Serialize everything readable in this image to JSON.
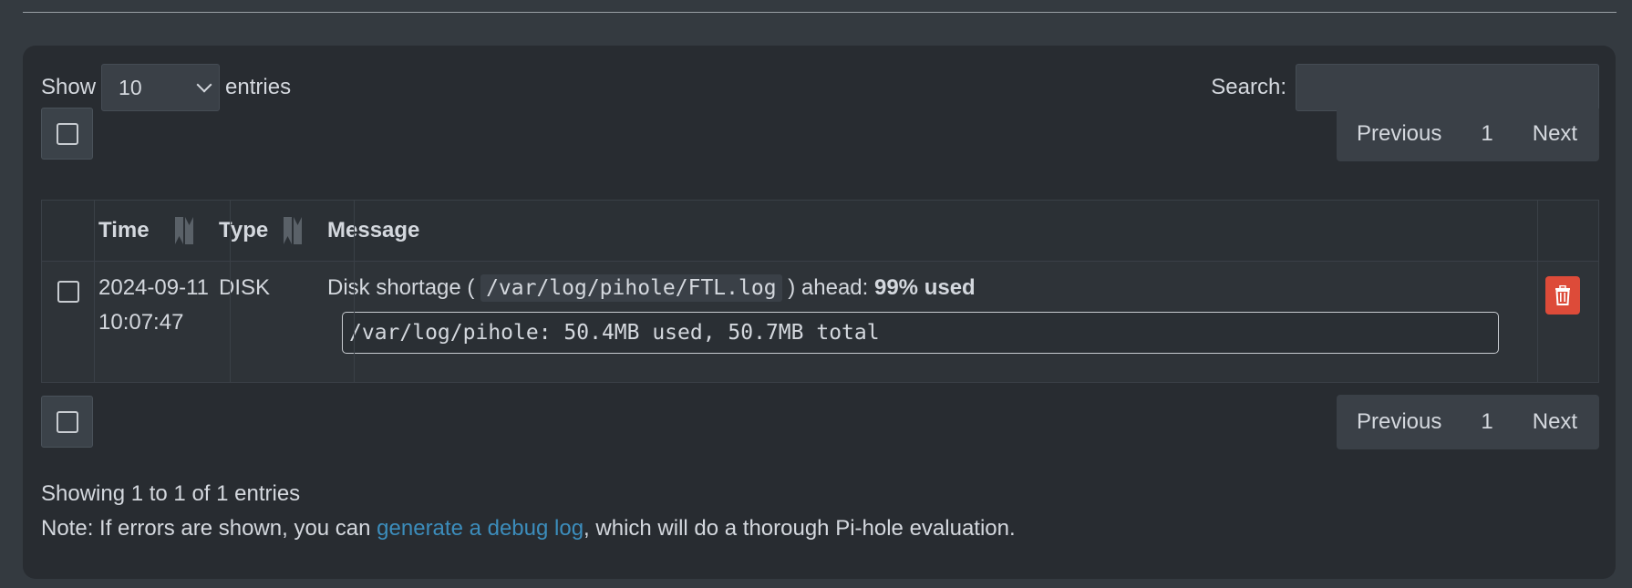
{
  "length": {
    "show_label": "Show",
    "selected_value": "10",
    "entries_label": "entries"
  },
  "search": {
    "label": "Search:",
    "value": "",
    "placeholder": ""
  },
  "pagination": {
    "previous": "Previous",
    "page": "1",
    "next": "Next"
  },
  "table": {
    "columns": [
      "Time",
      "Type",
      "Message"
    ],
    "rows": [
      {
        "date": "2024-09-11",
        "time": "10:07:47",
        "type": "DISK",
        "message_prefix": "Disk shortage (",
        "message_path": "/var/log/pihole/FTL.log",
        "message_mid": ") ahead:",
        "message_bold": "99% used",
        "detail": "/var/log/pihole: 50.4MB used, 50.7MB total"
      }
    ]
  },
  "footer": {
    "showing": "Showing 1 to 1 of 1 entries",
    "note_prefix": "Note: If errors are shown, you can",
    "note_link": "generate a debug log",
    "note_suffix": ", which will do a thorough Pi-hole evaluation."
  },
  "colors": {
    "background": "#343a40",
    "card": "#282c31",
    "link": "#3c8dbc",
    "delete": "#dd4b39"
  },
  "icons": {
    "sort": "sort-both-icon",
    "delete": "trash-icon",
    "dropdown": "chevron-down-icon"
  }
}
